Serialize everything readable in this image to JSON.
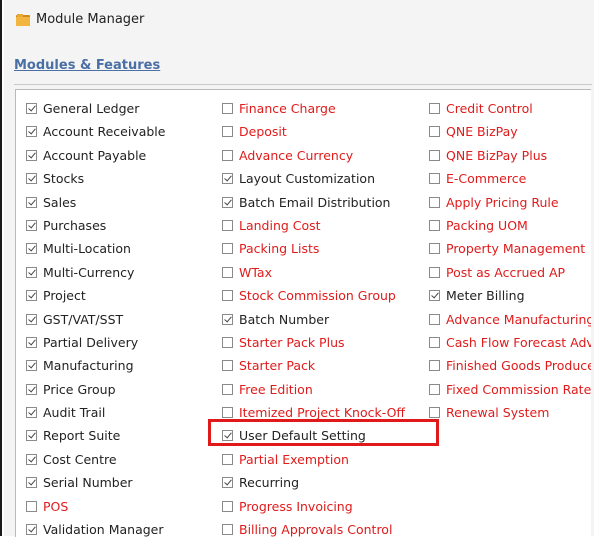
{
  "window": {
    "title": "Module Manager"
  },
  "section": {
    "link_label": "Modules & Features"
  },
  "colors": {
    "checked_label": "#222222",
    "unchecked_label": "#e01b1b",
    "highlight": "#e0191b",
    "link": "#4a6fa5"
  },
  "columns": [
    [
      {
        "label": "General Ledger",
        "checked": true
      },
      {
        "label": "Account Receivable",
        "checked": true
      },
      {
        "label": "Account Payable",
        "checked": true
      },
      {
        "label": "Stocks",
        "checked": true
      },
      {
        "label": "Sales",
        "checked": true
      },
      {
        "label": "Purchases",
        "checked": true
      },
      {
        "label": "Multi-Location",
        "checked": true
      },
      {
        "label": "Multi-Currency",
        "checked": true
      },
      {
        "label": "Project",
        "checked": true
      },
      {
        "label": "GST/VAT/SST",
        "checked": true
      },
      {
        "label": "Partial Delivery",
        "checked": true
      },
      {
        "label": "Manufacturing",
        "checked": true
      },
      {
        "label": "Price Group",
        "checked": true
      },
      {
        "label": "Audit Trail",
        "checked": true
      },
      {
        "label": "Report Suite",
        "checked": true
      },
      {
        "label": "Cost Centre",
        "checked": true
      },
      {
        "label": "Serial Number",
        "checked": true
      },
      {
        "label": "POS",
        "checked": false
      },
      {
        "label": "Validation Manager",
        "checked": true
      }
    ],
    [
      {
        "label": "Finance Charge",
        "checked": false
      },
      {
        "label": "Deposit",
        "checked": false
      },
      {
        "label": "Advance Currency",
        "checked": false
      },
      {
        "label": "Layout Customization",
        "checked": true
      },
      {
        "label": "Batch Email Distribution",
        "checked": true
      },
      {
        "label": "Landing Cost",
        "checked": false
      },
      {
        "label": "Packing Lists",
        "checked": false
      },
      {
        "label": "WTax",
        "checked": false
      },
      {
        "label": "Stock Commission Group",
        "checked": false
      },
      {
        "label": "Batch Number",
        "checked": true
      },
      {
        "label": "Starter Pack Plus",
        "checked": false
      },
      {
        "label": "Starter Pack",
        "checked": false
      },
      {
        "label": "Free Edition",
        "checked": false
      },
      {
        "label": "Itemized Project Knock-Off",
        "checked": false
      },
      {
        "label": "User Default Setting",
        "checked": true
      },
      {
        "label": "Partial Exemption",
        "checked": false
      },
      {
        "label": "Recurring",
        "checked": true
      },
      {
        "label": "Progress Invoicing",
        "checked": false
      },
      {
        "label": "Billing Approvals Control",
        "checked": false
      }
    ],
    [
      {
        "label": "Credit Control",
        "checked": false
      },
      {
        "label": "QNE BizPay",
        "checked": false
      },
      {
        "label": "QNE BizPay Plus",
        "checked": false
      },
      {
        "label": "E-Commerce",
        "checked": false
      },
      {
        "label": "Apply Pricing Rule",
        "checked": false
      },
      {
        "label": "Packing UOM",
        "checked": false
      },
      {
        "label": "Property Management",
        "checked": false
      },
      {
        "label": "Post as Accrued AP",
        "checked": false
      },
      {
        "label": "Meter Billing",
        "checked": true
      },
      {
        "label": "Advance Manufacturing",
        "checked": false
      },
      {
        "label": "Cash Flow Forecast Advis",
        "checked": false
      },
      {
        "label": "Finished Goods Produce",
        "checked": false
      },
      {
        "label": "Fixed Commission Rates",
        "checked": false
      },
      {
        "label": "Renewal System",
        "checked": false
      }
    ]
  ]
}
